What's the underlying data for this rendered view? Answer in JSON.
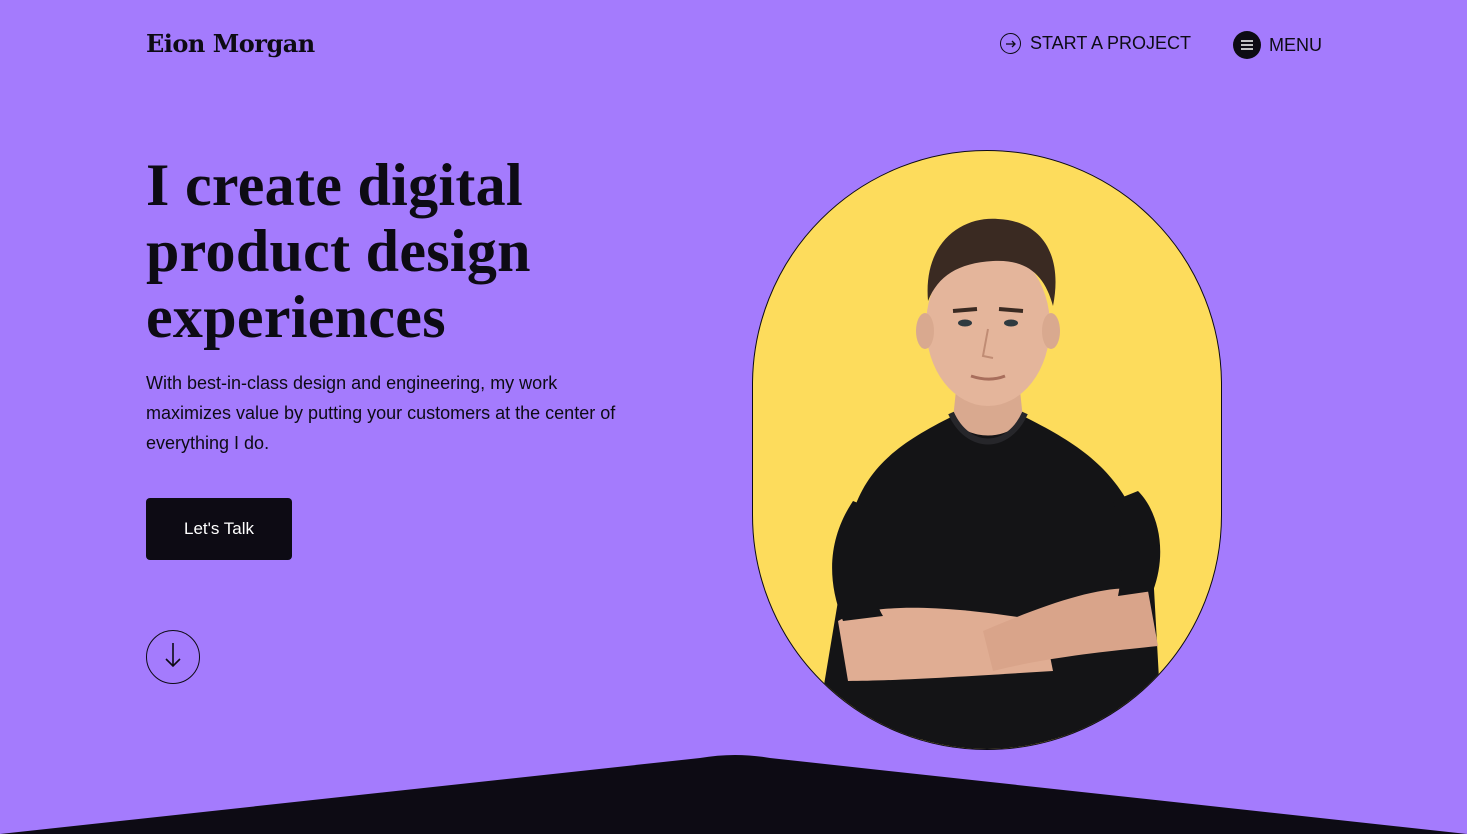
{
  "header": {
    "logo": "Eion Morgan",
    "cta_label": "START A PROJECT",
    "cta_icon": "arrow-right-circle-icon",
    "menu_label": "MENU",
    "menu_icon": "hamburger-icon"
  },
  "hero": {
    "headline_line1": "I create digital",
    "headline_line2": "product design",
    "headline_line3": "experiences",
    "subtext": "With best-in-class design and engineering, my work maximizes value by putting your customers at the center of everything I do.",
    "button_label": "Let's Talk",
    "scroll_icon": "arrow-down-icon"
  },
  "colors": {
    "background": "#a47bfd",
    "portrait_bg": "#fddc5c",
    "dark": "#0d0b14",
    "button_text": "#ffffff"
  }
}
